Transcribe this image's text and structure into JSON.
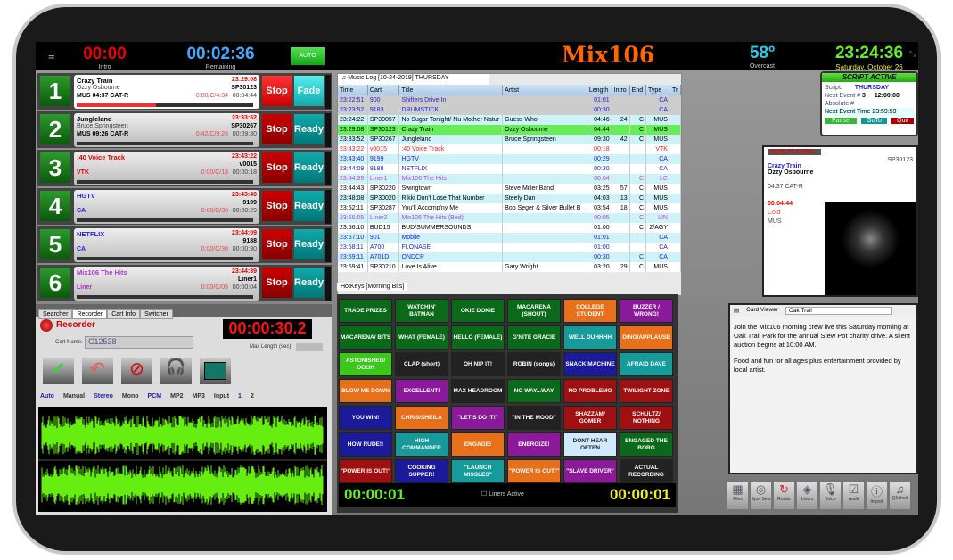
{
  "header": {
    "intro": "00:00",
    "intro_label": "Intro",
    "remaining": "00:02:36",
    "remaining_label": "Remaining",
    "auto": "AUTO",
    "logo": "Mix106",
    "temp": "58º",
    "weather": "Overcast",
    "clock": "23:24:36",
    "date": "Saturday, October 26"
  },
  "decks": [
    {
      "n": "1",
      "title": "Crazy Train",
      "artist": "Ozzy Osbourne",
      "meta": "MUS   04:37   CAT-R",
      "time": "23:29:08",
      "cart": "SP30123",
      "tc": "0:00/C/4:34",
      "dur": "00:04:44",
      "btn": "Fade",
      "color": "#000",
      "progress": 0.45
    },
    {
      "n": "2",
      "title": "Jungleland",
      "artist": "Bruce Springsteen",
      "meta": "MUS   09:26   CAT-R",
      "time": "23:33:52",
      "cart": "SP30267",
      "tc": "0:42/C/9:26",
      "dur": "00:09:30",
      "btn": "Ready",
      "color": "#000",
      "progress": 0
    },
    {
      "n": "3",
      "title": ":40 Voice Track",
      "artist": "",
      "meta": "VTK",
      "time": "23:43:22",
      "cart": "v0015",
      "tc": "0:00/C/18",
      "dur": "00:00:18",
      "btn": "Ready",
      "color": "#e00",
      "progress": 0
    },
    {
      "n": "4",
      "title": "HGTV",
      "artist": "",
      "meta": "CA",
      "time": "23:43:40",
      "cart": "9199",
      "tc": "0:00/C/30",
      "dur": "00:00:29",
      "btn": "Ready",
      "color": "#22d",
      "progress": 0
    },
    {
      "n": "5",
      "title": "NETFLIX",
      "artist": "",
      "meta": "CA",
      "time": "23:44:09",
      "cart": "9188",
      "tc": "0:00/C/30",
      "dur": "00:00:30",
      "btn": "Ready",
      "color": "#22d",
      "progress": 0
    },
    {
      "n": "6",
      "title": "Mix106 The Hits",
      "artist": "",
      "meta": "Liner",
      "time": "23:44:39",
      "cart": "Liner1",
      "tc": "0:00/C/05",
      "dur": "00:00:04",
      "btn": "Ready",
      "color": "#a3c",
      "progress": 0
    }
  ],
  "stop_label": "Stop",
  "recorder": {
    "tabs": [
      "Searcher",
      "Recorder",
      "Cart Info",
      "Switcher"
    ],
    "title": "Recorder",
    "timer": "00:00:30.2",
    "cart_label": "Cart Name:",
    "cart_value": "C12538",
    "maxlen_label": "Max Length (sec):",
    "opts": [
      "Auto",
      "Manual",
      "Stereo",
      "Mono",
      "PCM",
      "MP2",
      "MP3",
      "Input",
      "1",
      "2"
    ]
  },
  "log": {
    "tab": "Music Log [10-24-2019] THURSDAY",
    "cols": [
      "Time",
      "Cart",
      "Title",
      "Artist",
      "Length",
      "Intro",
      "End",
      "Type",
      "Tr"
    ],
    "rows": [
      [
        "23:22:51",
        "900",
        "Shifters Drive In",
        "",
        "01:01",
        "",
        "",
        "CA"
      ],
      [
        "23:23:52",
        "9183",
        "DRUMSTICK",
        "",
        "00:30",
        "",
        "",
        "CA"
      ],
      [
        "23:24:22",
        "SP30057",
        "No Sugar Tonight/ Nu Mother Natur",
        "Guess Who",
        "04:46",
        "24",
        "C",
        "MUS"
      ],
      [
        "23:29:08",
        "SP30123",
        "Crazy Train",
        "Ozzy Osbourne",
        "04:44",
        "",
        "C",
        "MUS"
      ],
      [
        "23:33:52",
        "SP30267",
        "Jungleland",
        "Bruce Springsteen",
        "09:30",
        "42",
        "C",
        "MUS"
      ],
      [
        "23:43:22",
        "v0015",
        ":40 Voice Track",
        "",
        "00:18",
        "",
        "",
        "VTK"
      ],
      [
        "23:43:40",
        "9199",
        "HGTV",
        "",
        "00:29",
        "",
        "",
        "CA"
      ],
      [
        "23:44:09",
        "9188",
        "NETFLIX",
        "",
        "00:30",
        "",
        "",
        "CA"
      ],
      [
        "23:44:39",
        "Liner1",
        "Mix106 The Hits",
        "",
        "00:04",
        "",
        "C",
        "LC"
      ],
      [
        "23:44:43",
        "SP30220",
        "Swingtown",
        "Steve Miller Band",
        "03:25",
        "57",
        "C",
        "MUS"
      ],
      [
        "23:48:08",
        "SP30020",
        "Rikki Don't Lose That Number",
        "Steely Dan",
        "04:03",
        "13",
        "C",
        "MUS"
      ],
      [
        "23:52:11",
        "SP30287",
        "You'll Accomp'ny Me",
        "Bob Seger & Silver Bullet B",
        "03:54",
        "18",
        "C",
        "MUS"
      ],
      [
        "23:56:05",
        "Liner2",
        "Mix106 The Hits (Bed)",
        "",
        "00:05",
        "",
        "C",
        "LIN"
      ],
      [
        "23:56:10",
        "BUD15",
        "BUD/SUMMERSOUNDS",
        "",
        "01:00",
        "",
        "C",
        "2/AGY"
      ],
      [
        "23:57:10",
        "901",
        "Mobile",
        "",
        "01:01",
        "",
        "",
        "CA"
      ],
      [
        "23:58:11",
        "A700",
        "FLONASE",
        "",
        "01:00",
        "",
        "",
        "CA"
      ],
      [
        "23:59:11",
        "A701D",
        "ONDCP",
        "",
        "00:30",
        "",
        "C",
        "CA"
      ],
      [
        "23:59:41",
        "SP30210",
        "Love Is Alive",
        "Gary Wright",
        "03:20",
        "29",
        "C",
        "MUS"
      ]
    ]
  },
  "hotkeys": {
    "tab": "HotKeys [Morning Bits]",
    "left_timer": "00:00:01",
    "right_timer": "00:00:01",
    "liners": "Liners Active",
    "keys": [
      [
        "TRADE PRIZES",
        "#0a6a1a"
      ],
      [
        "WATCHIN' BATMAN",
        "#0a6a1a"
      ],
      [
        "OKIE DOKIE",
        "#0a6a1a"
      ],
      [
        "MACARENA (SHOUT)",
        "#0a6a1a"
      ],
      [
        "COLLEGE STUDENT",
        "#e8701a"
      ],
      [
        "BUZZER / WRONG!",
        "#8a1a9a"
      ],
      [
        "MACARENA/ BITS",
        "#0a6a1a"
      ],
      [
        "WHAT (FEMALE)",
        "#0a6a1a"
      ],
      [
        "HELLO (FEMALE)",
        "#0a6a1a"
      ],
      [
        "G'NITE GRACIE",
        "#0a6a1a"
      ],
      [
        "WELL DUHHHH",
        "#169a9a"
      ],
      [
        "DING/APPLAUSE",
        "#e8701a"
      ],
      [
        "ASTONISHED/ OOOH",
        "#3cc81a"
      ],
      [
        "CLAP (short)",
        "#222"
      ],
      [
        "OH NIP IT!",
        "#222"
      ],
      [
        "ROBIN (songs)",
        "#222"
      ],
      [
        "SNACK MACHINE",
        "#1a1a9a"
      ],
      [
        "AFRAID DAVE",
        "#169a9a"
      ],
      [
        "BLOW ME DOWN",
        "#e8701a"
      ],
      [
        "EXCELLENT!",
        "#8a1a9a"
      ],
      [
        "MAX HEADROOM",
        "#222"
      ],
      [
        "NO WAY...WAY",
        "#0a6a1a"
      ],
      [
        "NO PROBLEMO",
        "#a01010"
      ],
      [
        "TWILIGHT ZONE",
        "#a01010"
      ],
      [
        "YOU WIN!",
        "#1a1a9a"
      ],
      [
        "CHRIS/SHEILA",
        "#e8701a"
      ],
      [
        "\"LET'S DO IT!\"",
        "#8a1a9a"
      ],
      [
        "\"IN THE MOOD\"",
        "#222"
      ],
      [
        "SHAZZAM/ GOMER",
        "#a01010"
      ],
      [
        "SCHULTZ/ NOTHING",
        "#a01010"
      ],
      [
        "HOW RUDE!!",
        "#1a1a9a"
      ],
      [
        "HIGH COMMANDER",
        "#169a9a"
      ],
      [
        "ENGAGE!",
        "#e8701a"
      ],
      [
        "ENERGIZE!",
        "#8a1a9a"
      ],
      [
        "DONT HEAR OFTEN",
        "#cfeaff"
      ],
      [
        "ENGAGED THE BORG",
        "#0a6a1a"
      ],
      [
        "\"POWER IS OUT!\"",
        "#a01010"
      ],
      [
        "COOKING SUPPER!",
        "#1a1a9a"
      ],
      [
        "\"LAUNCH MISSLES\"",
        "#169a9a"
      ],
      [
        "\"POWER IS OUT!\"",
        "#e8701a"
      ],
      [
        "\"SLAVE DRIVER\"",
        "#8a1a9a"
      ],
      [
        "ACTUAL RECORDING",
        "#222"
      ]
    ]
  },
  "script": {
    "title": "SCRIPT ACTIVE",
    "script_label": "Script:",
    "script": "THURSDAY",
    "next_label": "Next Event #",
    "next": "3",
    "next_time": "12:00:00",
    "abs_label": "Absolute #",
    "net_label": "Next Event Time",
    "net": "23:59:59",
    "pause": "Pause",
    "goto": "GoTo",
    "quit": "Quit"
  },
  "now": {
    "label": "NOW PLAYING",
    "cart": "SP30123",
    "title": "Crazy Train",
    "artist": "Ozzy Osbourne",
    "meta": "04:37   CAT-R",
    "dur": "00:04:44",
    "end": "Cold",
    "type": "MUS"
  },
  "card": {
    "label": "Card Viewer",
    "select": "Oak Trail",
    "p1": "Join the Mix106 morning crew live this Saturday morning  at Oak Trail Park for the annual Stew Pot charity drive. A silent auction begins at 10:00 AM.",
    "p2": "Food and fun for all ages plus entertainment provided by local artist."
  },
  "toolbar": [
    "Files",
    "Spot Sets",
    "Rotate",
    "Liners",
    "Voice",
    "Audit",
    "Import",
    "QSched"
  ]
}
